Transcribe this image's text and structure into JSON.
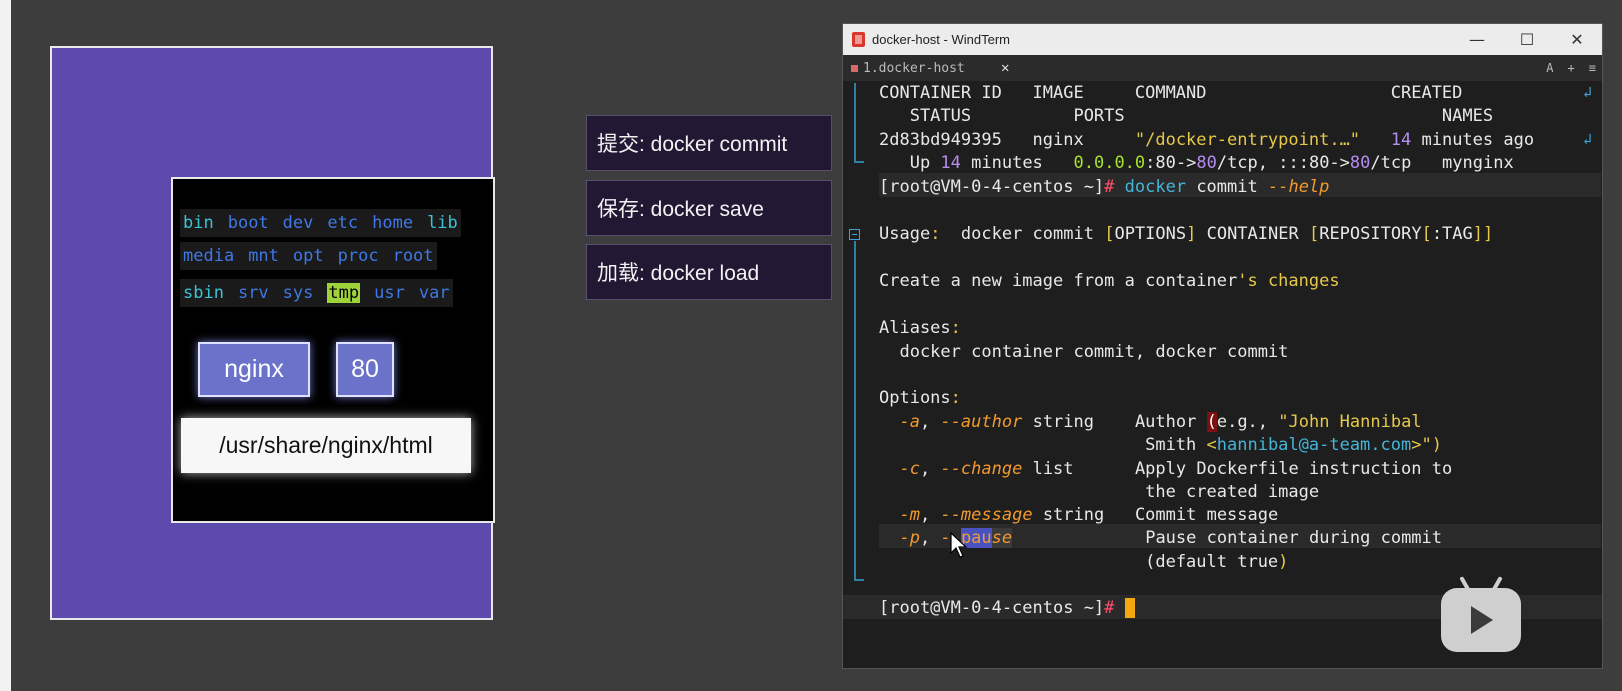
{
  "diagram": {
    "dir_rows": [
      [
        "bin",
        "boot",
        "dev",
        "etc",
        "home",
        "lib"
      ],
      [
        "media",
        "mnt",
        "opt",
        "proc",
        "root"
      ],
      [
        "sbin",
        "srv",
        "sys",
        "tmp",
        "usr",
        "var"
      ]
    ],
    "nginx": "nginx",
    "port": "80",
    "path": "/usr/share/nginx/html"
  },
  "labels": {
    "commit": "提交:  docker commit",
    "save": "保存:  docker save",
    "load": "加载:  docker load"
  },
  "window": {
    "title": "docker-host - WindTerm",
    "tab": "1.docker-host",
    "tab_close": "✕",
    "tools": [
      "A",
      "+",
      "≡"
    ],
    "buttons": [
      "—",
      "☐",
      "✕"
    ]
  },
  "terminal": {
    "ps_header1": "CONTAINER ID   IMAGE     COMMAND                  CREATED",
    "ps_header2": "   STATUS          PORTS                               NAMES",
    "ps_row1_id": "2d83bd949395   nginx     ",
    "ps_row1_cmd": "\"/docker-entrypoint.…\"",
    "ps_row1_num": "14",
    "ps_row1_created": " minutes ago",
    "ps_row2_up": "   Up ",
    "ps_row2_num": "14",
    "ps_row2_min": " minutes   ",
    "ps_row2_ip": "0.0.0.0",
    "ps_row2_p1": ":80->",
    "ps_row2_p2": "80",
    "ps_row2_p3": "/tcp, ",
    "ps_row2_p4": ":::80->",
    "ps_row2_p5": "80",
    "ps_row2_p6": "/tcp   mynginx",
    "prompt": "[root@VM-0-4-centos ~]",
    "prompt_hash": "#",
    "cmd_docker": " docker",
    "cmd_commit": " commit",
    "cmd_help": "--help",
    "usage_label": "Usage",
    "usage_colon": ":",
    "usage_text1": "  docker commit ",
    "usage_b1": "[",
    "usage_opt": "OPTIONS",
    "usage_b2": "]",
    "usage_text2": " CONTAINER ",
    "usage_b3": "[",
    "usage_repo": "REPOSITORY",
    "usage_b4": "[",
    "usage_tag": ":TAG",
    "usage_b5": "]]",
    "create_a": "Create a new image from a container",
    "create_b": "'s changes",
    "aliases_label": "Aliases",
    "aliases_text": "  docker container commit, docker commit",
    "options_label": "Options",
    "opt_a_short": "-a",
    "opt_a_long": "--author",
    "opt_a_type": " string    ",
    "opt_a_desc": "Author ",
    "opt_a_paren": "(",
    "opt_a_eg": "e.g., ",
    "opt_a_name": "\"John Hannibal",
    "opt_a2_pre": "                          Smith ",
    "opt_a2_lt": "<",
    "opt_a2_email": "hannibal@a-team.com",
    "opt_a2_end": ">\")",
    "opt_c_short": "-c",
    "opt_c_long": "--change",
    "opt_c_type": " list      ",
    "opt_c_desc": "Apply Dockerfile instruction to",
    "opt_c2": "                          the created image",
    "opt_m_short": "-m",
    "opt_m_long": "--message",
    "opt_m_type": " string   ",
    "opt_m_desc": "Commit message",
    "opt_p_short": "-p",
    "opt_p_long_pre": "--",
    "opt_p_long_sel": "pau",
    "opt_p_long_post": "se",
    "opt_p_desc": "Pause container during commit",
    "opt_p2_pre": "                          ",
    "opt_p2_text": "(default true",
    "opt_p2_close": ")",
    "comma": ", "
  }
}
